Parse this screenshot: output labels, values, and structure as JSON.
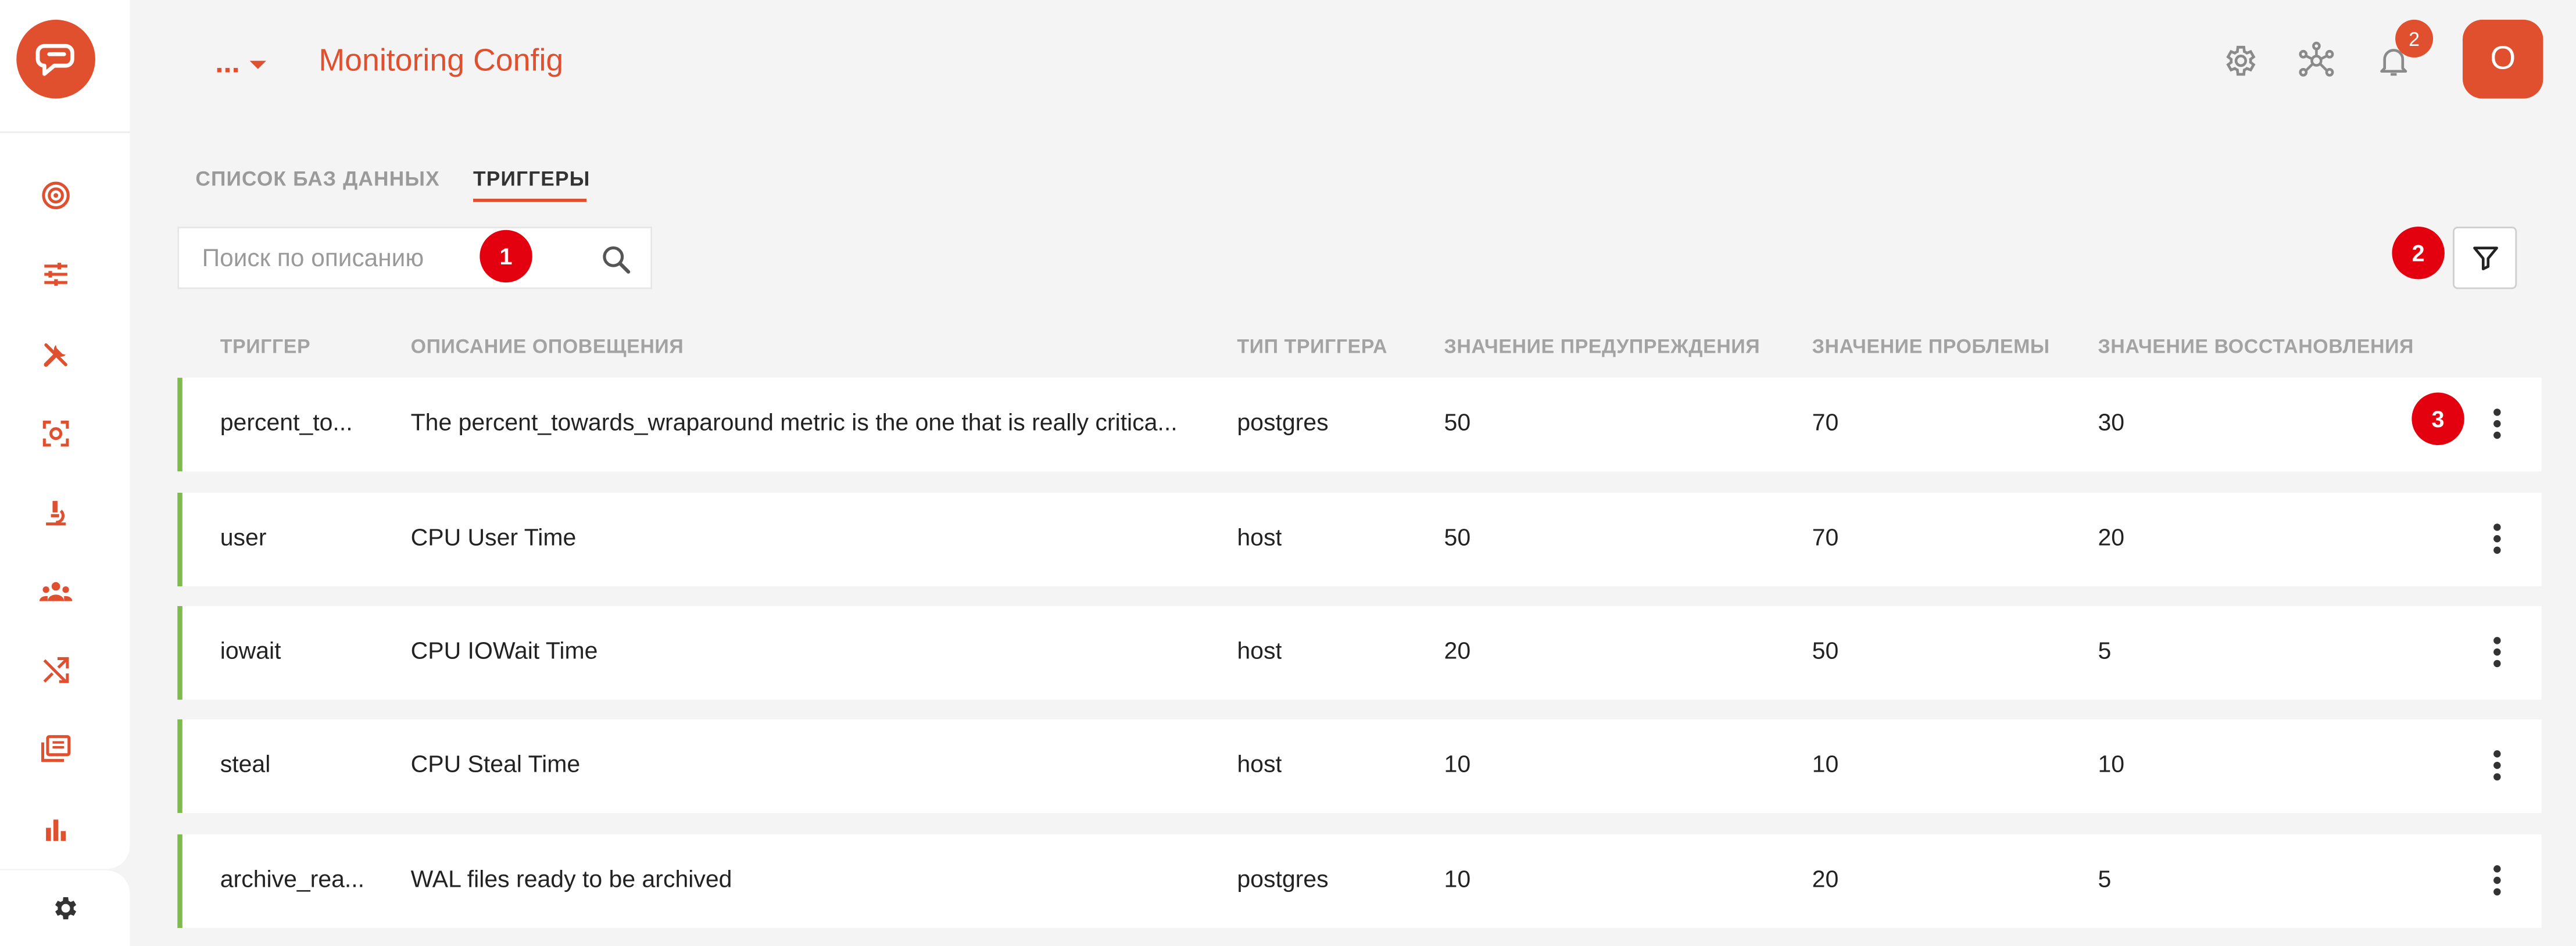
{
  "colors": {
    "accent": "#e0502f",
    "hint_red": "#e3000f",
    "row_stripe": "#7dbb4c",
    "background": "#f4f4f5"
  },
  "header": {
    "more_label": "...",
    "title": "Monitoring Config",
    "notification_count": "2",
    "avatar_initial": "O",
    "icons": [
      "settings-icon",
      "network-icon",
      "bell-icon"
    ]
  },
  "sidebar": {
    "items": [
      {
        "icon": "target-icon"
      },
      {
        "icon": "sliders-icon"
      },
      {
        "icon": "tools-icon"
      },
      {
        "icon": "scan-icon"
      },
      {
        "icon": "microscope-icon"
      },
      {
        "icon": "group-icon"
      },
      {
        "icon": "shuffle-icon"
      },
      {
        "icon": "library-icon"
      },
      {
        "icon": "bar-chart-icon"
      },
      {
        "icon": "gear-icon"
      }
    ]
  },
  "tabs": [
    {
      "label": "СПИСОК БАЗ ДАННЫХ",
      "active": false
    },
    {
      "label": "ТРИГГЕРЫ",
      "active": true
    }
  ],
  "search": {
    "placeholder": "Поиск по описанию",
    "value": ""
  },
  "hints": [
    "1",
    "2",
    "3"
  ],
  "table": {
    "columns": [
      "ТРИГГЕР",
      "ОПИСАНИЕ ОПОВЕЩЕНИЯ",
      "ТИП ТРИГГЕРА",
      "ЗНАЧЕНИЕ ПРЕДУПРЕЖДЕНИЯ",
      "ЗНАЧЕНИЕ ПРОБЛЕМЫ",
      "ЗНАЧЕНИЕ ВОССТАНОВЛЕНИЯ"
    ],
    "rows": [
      {
        "trigger": "percent_to...",
        "description": "The percent_towards_wraparound metric is the one that is really critica...",
        "type": "postgres",
        "warning": "50",
        "problem": "70",
        "recovery": "30"
      },
      {
        "trigger": "user",
        "description": "CPU User Time",
        "type": "host",
        "warning": "50",
        "problem": "70",
        "recovery": "20"
      },
      {
        "trigger": "iowait",
        "description": "CPU IOWait Time",
        "type": "host",
        "warning": "20",
        "problem": "50",
        "recovery": "5"
      },
      {
        "trigger": "steal",
        "description": "CPU Steal Time",
        "type": "host",
        "warning": "10",
        "problem": "10",
        "recovery": "10"
      },
      {
        "trigger": "archive_rea...",
        "description": "WAL files ready to be archived",
        "type": "postgres",
        "warning": "10",
        "problem": "20",
        "recovery": "5"
      }
    ]
  }
}
